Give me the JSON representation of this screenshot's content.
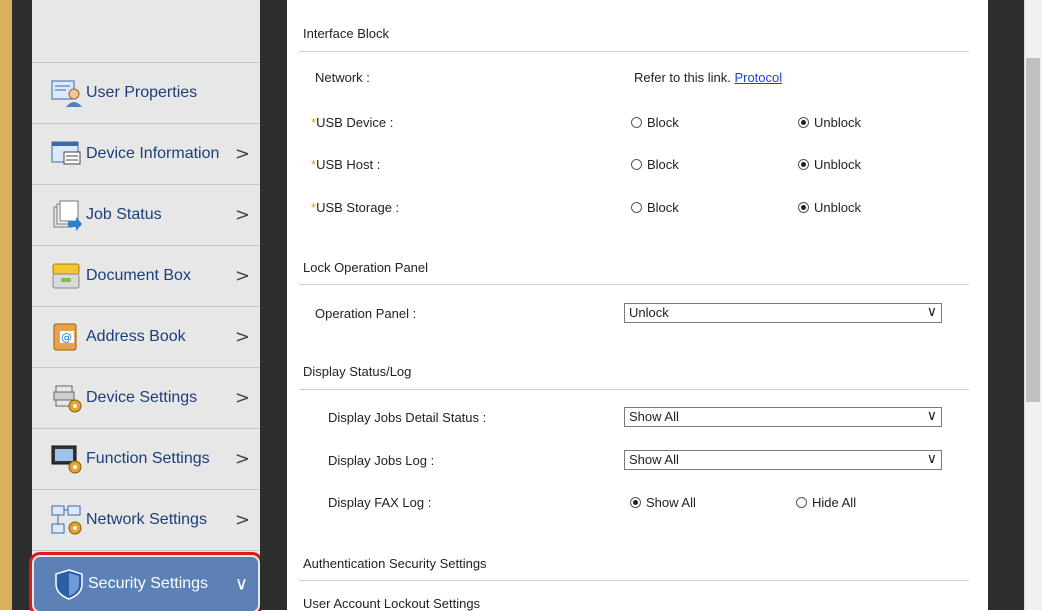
{
  "sidebar": {
    "items": [
      {
        "label": "User Properties",
        "icon": "user-properties-icon",
        "chevron": ""
      },
      {
        "label": "Device Information",
        "icon": "device-information-icon",
        "chevron": ">"
      },
      {
        "label": "Job Status",
        "icon": "job-status-icon",
        "chevron": ">"
      },
      {
        "label": "Document Box",
        "icon": "document-box-icon",
        "chevron": ">"
      },
      {
        "label": "Address Book",
        "icon": "address-book-icon",
        "chevron": ">"
      },
      {
        "label": "Device Settings",
        "icon": "device-settings-icon",
        "chevron": ">"
      },
      {
        "label": "Function Settings",
        "icon": "function-settings-icon",
        "chevron": ">"
      },
      {
        "label": "Network Settings",
        "icon": "network-settings-icon",
        "chevron": ">"
      },
      {
        "label": "Security Settings",
        "icon": "shield-icon",
        "chevron": "∨"
      }
    ]
  },
  "sections": {
    "interface_block": {
      "title": "Interface Block",
      "network": {
        "label": "Network :",
        "text": "Refer to this link.",
        "link": "Protocol"
      },
      "usb_device": {
        "asterisk": "*",
        "label": "USB Device :",
        "opt1": "Block",
        "opt2": "Unblock",
        "selected": "Unblock"
      },
      "usb_host": {
        "asterisk": "*",
        "label": "USB Host :",
        "opt1": "Block",
        "opt2": "Unblock",
        "selected": "Unblock"
      },
      "usb_storage": {
        "asterisk": "*",
        "label": "USB Storage :",
        "opt1": "Block",
        "opt2": "Unblock",
        "selected": "Unblock"
      }
    },
    "lock_operation_panel": {
      "title": "Lock Operation Panel",
      "operation_panel": {
        "label": "Operation Panel :",
        "value": "Unlock"
      }
    },
    "display_status_log": {
      "title": "Display Status/Log",
      "jobs_detail": {
        "label": "Display Jobs Detail Status :",
        "value": "Show All"
      },
      "jobs_log": {
        "label": "Display Jobs Log :",
        "value": "Show All"
      },
      "fax_log": {
        "label": "Display FAX Log :",
        "opt1": "Show All",
        "opt2": "Hide All",
        "selected": "Show All"
      }
    },
    "authentication_security": {
      "title": "Authentication Security Settings"
    },
    "user_account_lockout": {
      "title": "User Account Lockout Settings"
    }
  },
  "colors": {
    "accent_active": "#5b81b6",
    "highlight_outline": "#d81b1b",
    "link": "#1d3fd8",
    "required_asterisk": "#e6a000"
  }
}
